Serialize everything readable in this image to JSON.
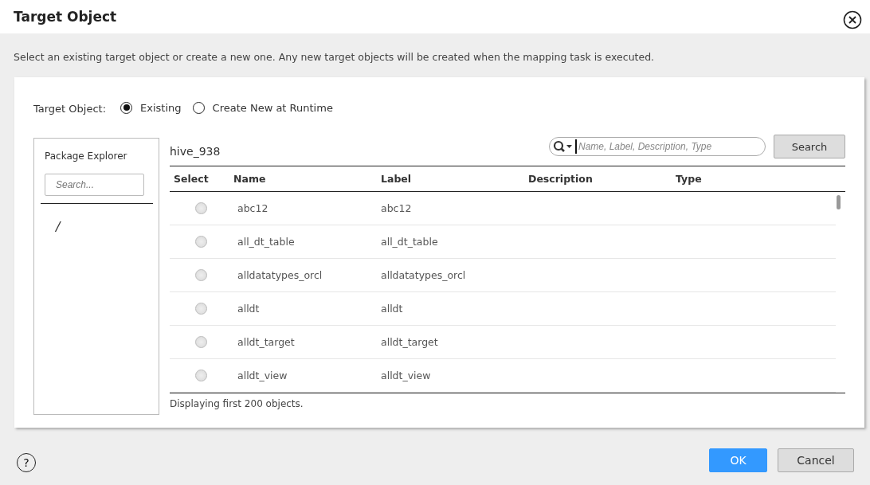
{
  "window": {
    "title": "Target Object"
  },
  "description": "Select an existing target object or create a new one. Any new target objects will be created when the mapping task is executed.",
  "target_object": {
    "label": "Target Object:",
    "options": [
      {
        "label": "Existing",
        "selected": true
      },
      {
        "label": "Create New at Runtime",
        "selected": false
      }
    ]
  },
  "package_explorer": {
    "title": "Package Explorer",
    "search": {
      "placeholder": "Search..."
    },
    "items": [
      {
        "label": "/",
        "selected": false
      }
    ]
  },
  "connection": "hive_938",
  "search": {
    "placeholder": "Name, Label, Description, Type",
    "button": "Search"
  },
  "table": {
    "columns": [
      "Select",
      "Name",
      "Label",
      "Description",
      "Type"
    ],
    "rows": [
      {
        "selected": false,
        "name": "abc12",
        "label": "abc12"
      },
      {
        "selected": false,
        "name": "all_dt_table",
        "label": "all_dt_table"
      },
      {
        "selected": false,
        "name": "alldatatypes_orcl",
        "label": "alldatatypes_orcl"
      },
      {
        "selected": false,
        "name": "alldt",
        "label": "alldt"
      },
      {
        "selected": false,
        "name": "alldt_target",
        "label": "alldt_target"
      },
      {
        "selected": false,
        "name": "alldt_view",
        "label": "alldt_view"
      }
    ]
  },
  "status": "Displaying first 200 objects.",
  "help": "?",
  "buttons": [
    {
      "label": "OK",
      "kind": "primary"
    },
    {
      "label": "Cancel",
      "kind": "secondary"
    }
  ]
}
